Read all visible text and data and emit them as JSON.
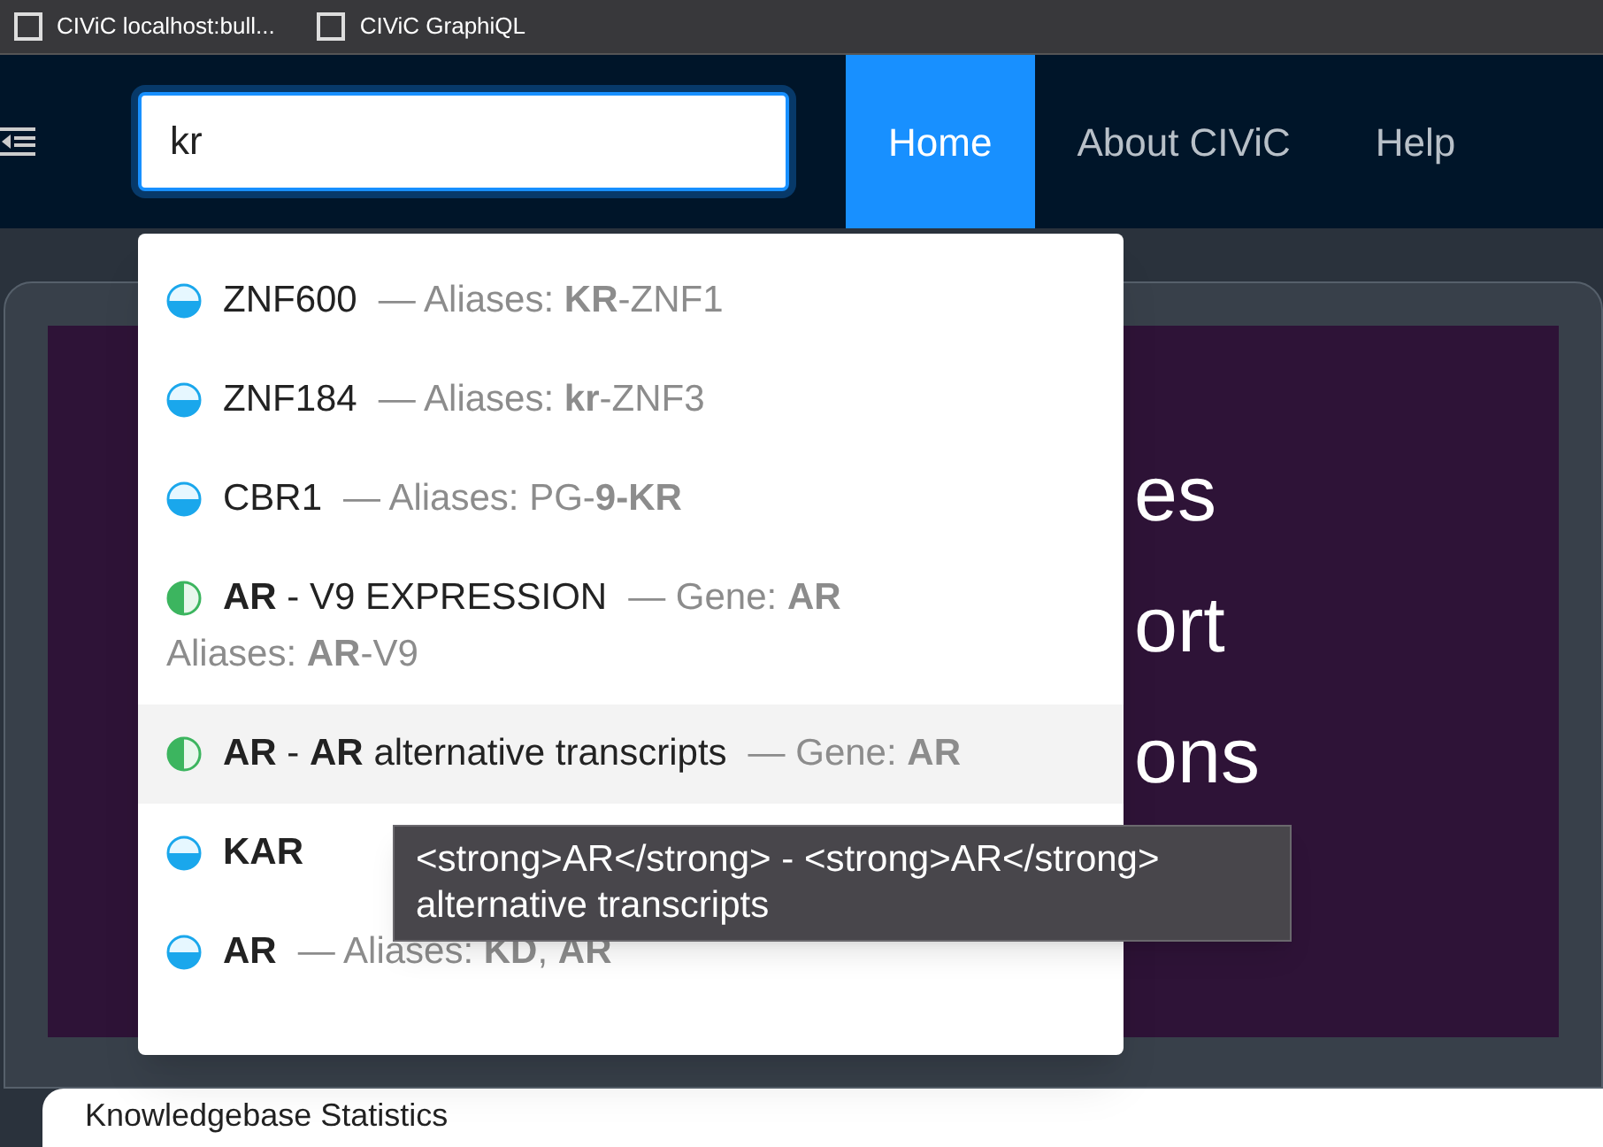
{
  "bookmarks": [
    {
      "label": "CIViC localhost:bull..."
    },
    {
      "label": "CIViC GraphiQL"
    }
  ],
  "search": {
    "value": "kr"
  },
  "nav": [
    {
      "label": "Home",
      "selected": true
    },
    {
      "label": "About CIViC",
      "selected": false
    },
    {
      "label": "Help",
      "selected": false
    }
  ],
  "hero": {
    "lines": [
      "es",
      "ort",
      "ons"
    ]
  },
  "suggestions": [
    {
      "kind": "gene",
      "name": "ZNF600",
      "detail": "— Aliases: **KR**-ZNF1",
      "selected": false
    },
    {
      "kind": "gene",
      "name": "ZNF184",
      "detail": "— Aliases: **kr**-ZNF3",
      "selected": false
    },
    {
      "kind": "gene",
      "name": "CBR1",
      "detail": "— Aliases: PG-**9-KR**",
      "selected": false
    },
    {
      "kind": "profile",
      "name": "**AR** - V9 EXPRESSION",
      "detail": "— Gene: **AR**",
      "extra": "Aliases: **AR**-V9",
      "selected": false
    },
    {
      "kind": "profile",
      "name": "**AR** - **AR** alternative transcripts",
      "detail": "— Gene: **AR**",
      "selected": true
    },
    {
      "kind": "gene",
      "name": "**KAR**",
      "selected": false
    },
    {
      "kind": "gene",
      "name": "**AR**",
      "detail": "— Aliases: **KD**, **AR**",
      "selected": false
    }
  ],
  "tooltip": {
    "text": "<strong>AR</strong> - <strong>AR</strong> alternative transcripts"
  },
  "stats": {
    "title": "Knowledgebase Statistics"
  }
}
